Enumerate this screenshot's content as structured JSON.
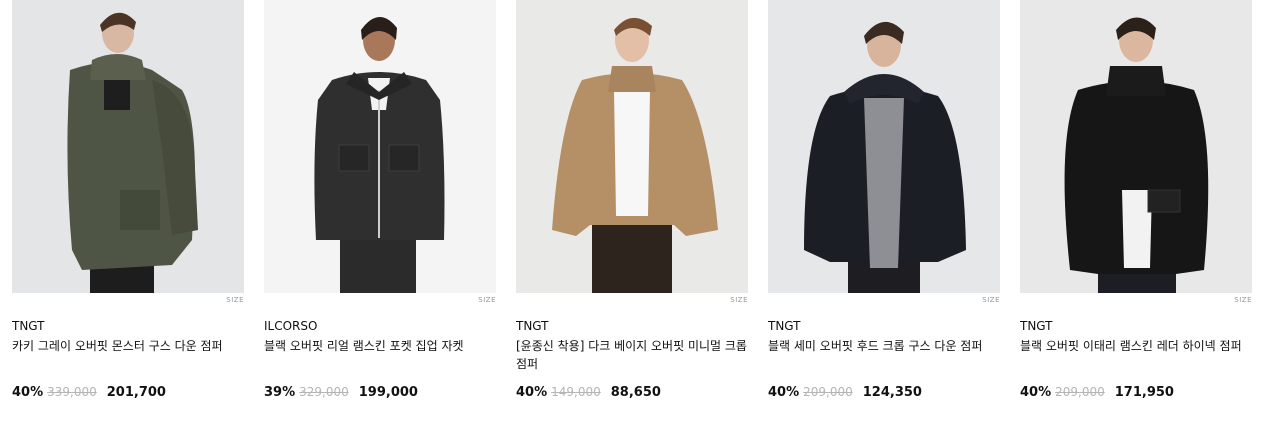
{
  "products": [
    {
      "brand": "TNGT",
      "name": "카키 그레이 오버핏 몬스터 구스 다운 점퍼",
      "size_tag": "SIZE",
      "discount": "40%",
      "original_price": "339,000",
      "price": "201,700",
      "image": "model-khaki-parka",
      "jacket_color": "#4f5544",
      "bg_color": "#e4e5e6"
    },
    {
      "brand": "ILCORSO",
      "name": "블랙 오버핏 리얼 램스킨 포켓 집업 자켓",
      "size_tag": "SIZE",
      "discount": "39%",
      "original_price": "329,000",
      "price": "199,000",
      "image": "model-black-leather-jacket",
      "jacket_color": "#2a2a2a",
      "bg_color": "#f4f4f4"
    },
    {
      "brand": "TNGT",
      "name": "[윤종신 착용] 다크 베이지 오버핏 미니멀 크롭 점퍼",
      "size_tag": "SIZE",
      "discount": "40%",
      "original_price": "149,000",
      "price": "88,650",
      "image": "model-beige-crop-jumper",
      "jacket_color": "#b58f66",
      "bg_color": "#e9e9e8"
    },
    {
      "brand": "TNGT",
      "name": "블랙 세미 오버핏 후드 크롭 구스 다운 점퍼",
      "size_tag": "SIZE",
      "discount": "40%",
      "original_price": "209,000",
      "price": "124,350",
      "image": "model-black-hooded-down",
      "jacket_color": "#1c1e26",
      "bg_color": "#e6e7e9"
    },
    {
      "brand": "TNGT",
      "name": "블랙 오버핏 이태리 램스킨 레더 하이넥 점퍼",
      "size_tag": "SIZE",
      "discount": "40%",
      "original_price": "209,000",
      "price": "171,950",
      "image": "model-black-leather-highneck",
      "jacket_color": "#161616",
      "bg_color": "#e8e8e8"
    }
  ]
}
